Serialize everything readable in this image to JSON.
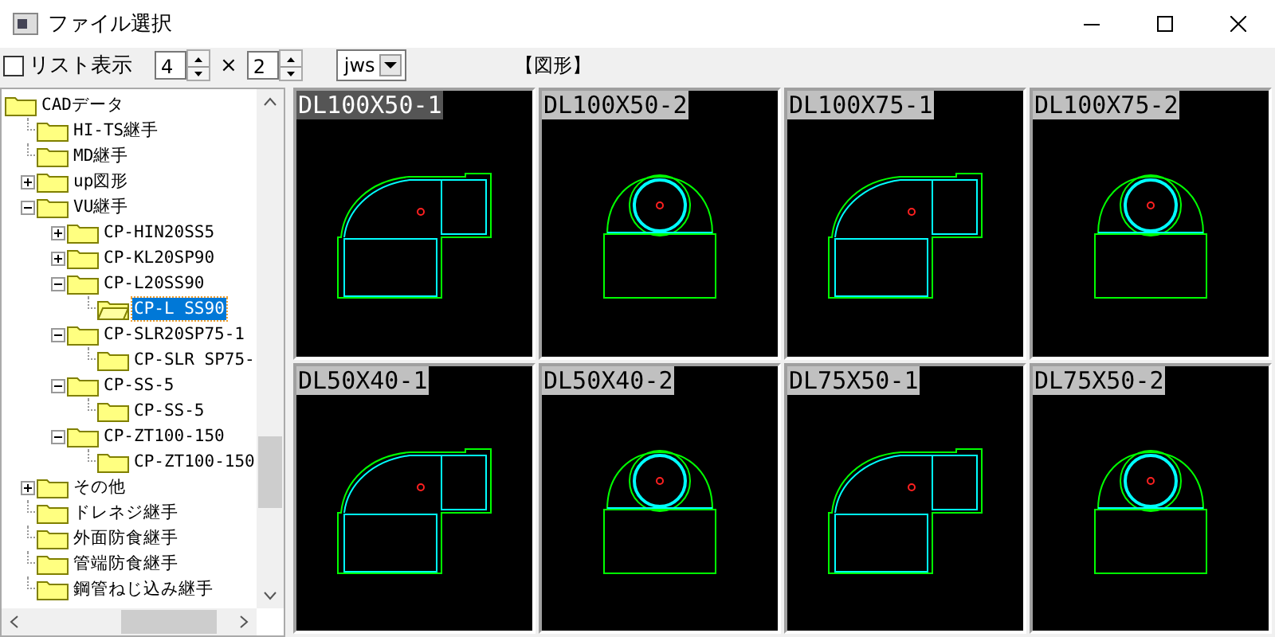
{
  "window": {
    "title": "ファイル選択"
  },
  "toolbar": {
    "list_view": {
      "label": "リスト表示",
      "checked": false
    },
    "columns": "4",
    "times": "×",
    "rows": "2",
    "format": "jws",
    "section_label": "【図形】"
  },
  "tree": [
    {
      "label": "CADデータ",
      "children": [
        {
          "label": "HI-TS継手",
          "selected": false
        },
        {
          "label": "MD継手",
          "selected": false
        },
        {
          "label": "up図形",
          "expanded": false,
          "selected": false
        },
        {
          "label": "VU継手",
          "expanded": true,
          "selected": false,
          "children": [
            {
              "label": "CP-HIN20SS5",
              "expanded": false,
              "selected": false
            },
            {
              "label": "CP-KL20SP90",
              "expanded": false,
              "selected": false
            },
            {
              "label": "CP-L20SS90",
              "expanded": true,
              "selected": false,
              "children": [
                {
                  "label": "CP-L SS90",
                  "selected": true,
                  "open": true
                }
              ]
            },
            {
              "label": "CP-SLR20SP75-1",
              "expanded": true,
              "selected": false,
              "children": [
                {
                  "label": "CP-SLR SP75-",
                  "selected": false
                }
              ]
            },
            {
              "label": "CP-SS-5",
              "expanded": true,
              "selected": false,
              "children": [
                {
                  "label": "CP-SS-5",
                  "selected": false
                }
              ]
            },
            {
              "label": "CP-ZT100-150",
              "expanded": true,
              "selected": false,
              "children": [
                {
                  "label": "CP-ZT100-150",
                  "selected": false
                }
              ]
            }
          ]
        },
        {
          "label": "その他",
          "expanded": false,
          "selected": false
        },
        {
          "label": "ドレネジ継手",
          "selected": false
        },
        {
          "label": "外面防食継手",
          "selected": false
        },
        {
          "label": "管端防食継手",
          "selected": false
        },
        {
          "label": "鋼管ねじ込み継手",
          "selected": false
        }
      ]
    }
  ],
  "thumbnails": [
    {
      "name": "DL100X50-1",
      "kind": "side",
      "selected": true
    },
    {
      "name": "DL100X50-2",
      "kind": "front",
      "selected": false
    },
    {
      "name": "DL100X75-1",
      "kind": "side",
      "selected": false
    },
    {
      "name": "DL100X75-2",
      "kind": "front",
      "selected": false
    },
    {
      "name": "DL50X40-1",
      "kind": "side",
      "selected": false
    },
    {
      "name": "DL50X40-2",
      "kind": "front",
      "selected": false
    },
    {
      "name": "DL75X50-1",
      "kind": "side",
      "selected": false
    },
    {
      "name": "DL75X50-2",
      "kind": "front",
      "selected": false
    }
  ]
}
